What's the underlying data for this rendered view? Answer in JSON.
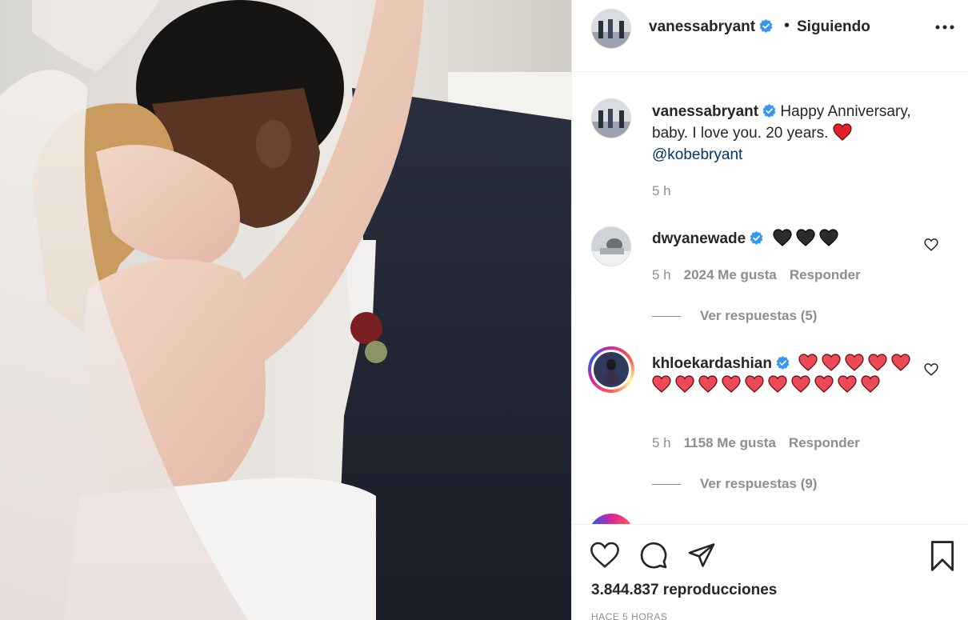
{
  "post": {
    "username": "vanessabryant",
    "follow_status": "Siguiendo",
    "caption_text": "Happy Anniversary, baby. I love you. 20 years.",
    "caption_mention": "@kobebryant",
    "caption_time": "5 h",
    "views": "3.844.837 reproducciones",
    "posted_ago": "HACE 5 HORAS"
  },
  "comments": [
    {
      "username": "dwyanewade",
      "hearts": "black",
      "heart_count": 3,
      "time": "5 h",
      "likes": "2024 Me gusta",
      "reply_label": "Responder",
      "view_replies": "Ver respuestas (5)"
    },
    {
      "username": "khloekardashian",
      "hearts": "red",
      "heart_count": 15,
      "time": "5 h",
      "likes": "1158 Me gusta",
      "reply_label": "Responder",
      "view_replies": "Ver respuestas (9)"
    }
  ],
  "icons": {
    "more": "more-options-icon",
    "like": "heart-outline-icon",
    "comment": "comment-icon",
    "share": "paper-plane-icon",
    "save": "bookmark-icon",
    "verified": "verified-badge-icon"
  },
  "colors": {
    "verified_blue": "#3897f0",
    "heart_red": "#ed4956",
    "mention_blue": "#00376b",
    "muted_text": "#8e8e8e"
  }
}
